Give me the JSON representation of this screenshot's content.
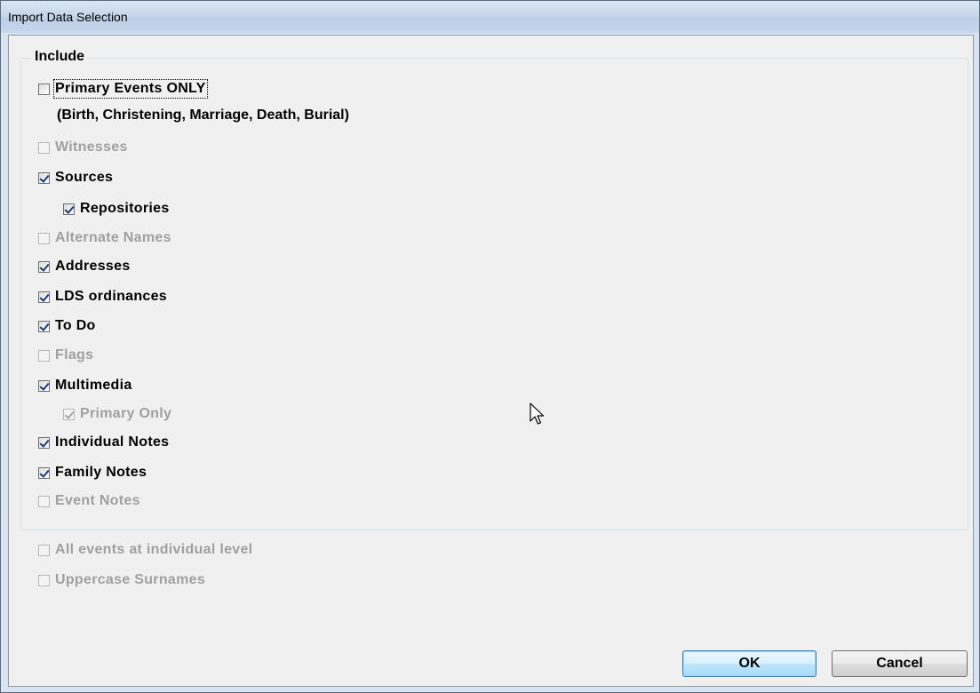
{
  "window": {
    "title": "Import Data Selection"
  },
  "include_group": {
    "legend": "Include",
    "primary_events": {
      "label": "Primary Events ONLY",
      "checked": false,
      "enabled": true
    },
    "primary_events_note": "(Birth, Christening, Marriage, Death, Burial)",
    "witnesses": {
      "label": "Witnesses",
      "checked": false,
      "enabled": false
    },
    "sources": {
      "label": "Sources",
      "checked": true,
      "enabled": true
    },
    "repositories": {
      "label": "Repositories",
      "checked": true,
      "enabled": true
    },
    "alternate_names": {
      "label": "Alternate Names",
      "checked": false,
      "enabled": false
    },
    "addresses": {
      "label": "Addresses",
      "checked": true,
      "enabled": true
    },
    "lds_ordinances": {
      "label": "LDS ordinances",
      "checked": true,
      "enabled": true
    },
    "to_do": {
      "label": "To Do",
      "checked": true,
      "enabled": true
    },
    "flags": {
      "label": "Flags",
      "checked": false,
      "enabled": false
    },
    "multimedia": {
      "label": "Multimedia",
      "checked": true,
      "enabled": true
    },
    "primary_only": {
      "label": "Primary Only",
      "checked": true,
      "enabled": false
    },
    "individual_notes": {
      "label": "Individual Notes",
      "checked": true,
      "enabled": true
    },
    "family_notes": {
      "label": "Family Notes",
      "checked": true,
      "enabled": true
    },
    "event_notes": {
      "label": "Event Notes",
      "checked": false,
      "enabled": false
    }
  },
  "extra_options": {
    "all_events_individual": {
      "label": "All events at individual level",
      "checked": false,
      "enabled": false
    },
    "uppercase_surnames": {
      "label": "Uppercase Surnames",
      "checked": false,
      "enabled": false
    }
  },
  "buttons": {
    "ok_label": "OK",
    "cancel_label": "Cancel"
  },
  "icons": {
    "checkbox_checked": "checkmark-icon",
    "cursor": "mouse-pointer-icon"
  },
  "colors": {
    "title_bar": "#c8d7ea",
    "dialog_bg": "#f0f0f0",
    "disabled_text": "#a0a0a0",
    "check_mark": "#1c3a7a"
  }
}
